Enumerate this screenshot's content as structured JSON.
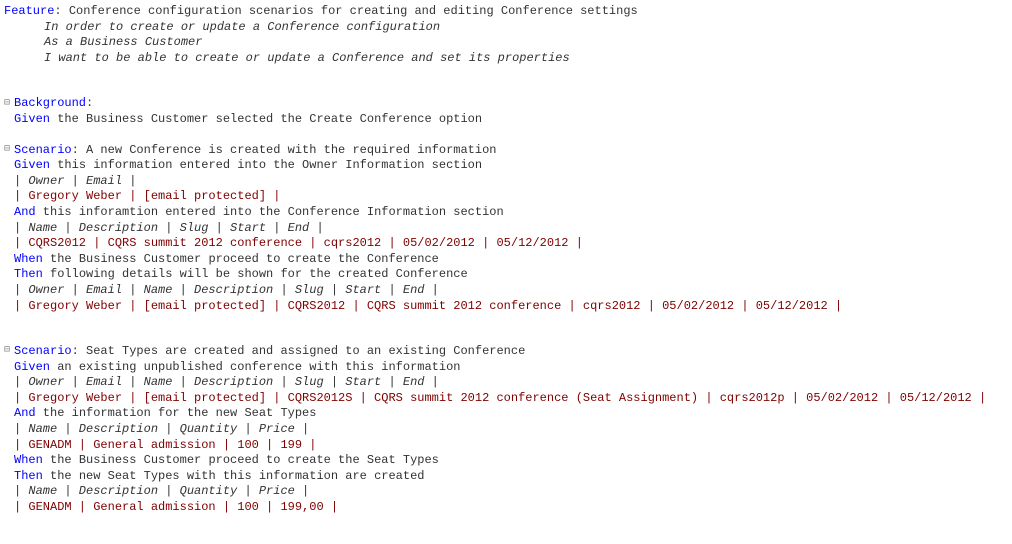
{
  "markers": {
    "expand": "⊟"
  },
  "feature": {
    "kw": "Feature",
    "title": ":  Conference configuration scenarios for creating and editing Conference settings",
    "narrative": [
      "In order to create or update a Conference configuration",
      "As a Business Customer",
      "I want to be able to create or update a Conference and set its properties"
    ]
  },
  "background": {
    "kw": "Background",
    "colon": ":",
    "given_kw": "Given",
    "given_text": " the Business Customer selected the Create Conference option"
  },
  "scenario1": {
    "kw": "Scenario",
    "title": ": A new Conference is created with the required information",
    "s1": {
      "kw": "Given",
      "text": " this information entered into the Owner Information section"
    },
    "t1h": "| Owner         | Email                    |",
    "t1r": "| Gregory Weber | [email protected] |",
    "s2": {
      "kw": "And",
      "text": " this inforamtion entered into the Conference Information section"
    },
    "t2h": "| Name     | Description                 | Slug     | Start      | End        |",
    "t2r": "| CQRS2012 | CQRS summit 2012 conference | cqrs2012 | 05/02/2012 | 05/12/2012 |",
    "s3": {
      "kw": "When",
      "text": " the Business Customer proceed to create the Conference"
    },
    "s4": {
      "kw": "Then",
      "text": " following details will be shown for the created Conference"
    },
    "t3h": "| Owner         | Email                    | Name     | Description                 | Slug     | Start      | End        |",
    "t3r": "| Gregory Weber | [email protected] | CQRS2012 | CQRS summit 2012 conference | cqrs2012 | 05/02/2012 | 05/12/2012 |"
  },
  "scenario2": {
    "kw": "Scenario",
    "title": ": Seat Types are created and assigned to an existing Conference",
    "s1": {
      "kw": "Given",
      "text": " an existing unpublished conference with this information"
    },
    "t1h": "| Owner         | Email                    | Name      | Description                                   | Slug      | Start      | End        |",
    "t1r": "| Gregory Weber | [email protected] | CQRS2012S | CQRS summit 2012 conference (Seat Assignment) | cqrs2012p | 05/02/2012 | 05/12/2012 |",
    "s2": {
      "kw": "And",
      "text": " the information for the new Seat Types"
    },
    "t2h": "| Name   | Description       | Quantity | Price |",
    "t2r": "| GENADM | General admission | 100      | 199   |",
    "s3": {
      "kw": "When",
      "text": " the Business Customer proceed to create the Seat Types"
    },
    "s4": {
      "kw": "Then",
      "text": " the new Seat Types with this information are created"
    },
    "t3h": "| Name   | Description       | Quantity | Price  |",
    "t3r": "| GENADM | General admission | 100      | 199,00 |"
  }
}
